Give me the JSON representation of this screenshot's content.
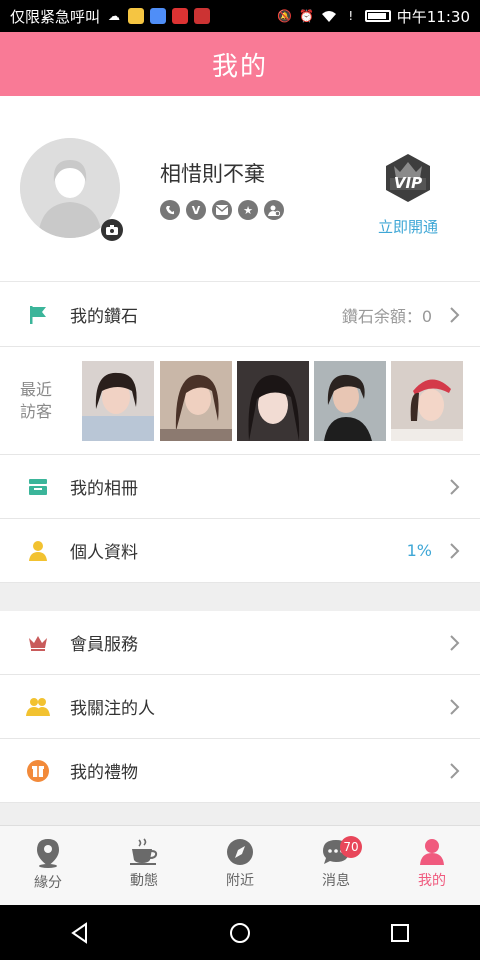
{
  "status_bar": {
    "carrier_text": "仅限紧急呼叫",
    "time": "中午11:30"
  },
  "header": {
    "title": "我的"
  },
  "profile": {
    "nickname": "相惜則不棄",
    "vip_action": "立即開通",
    "vip_badge": "VIP"
  },
  "diamond_row": {
    "label": "我的鑽石",
    "value": "鑽石余額：0"
  },
  "visitors": {
    "title": "最近訪客",
    "count": 5
  },
  "menu": {
    "album": {
      "label": "我的相冊"
    },
    "personal_info": {
      "label": "個人資料",
      "value": "1%"
    },
    "membership": {
      "label": "會員服務"
    },
    "following": {
      "label": "我關注的人"
    },
    "gifts": {
      "label": "我的禮物"
    }
  },
  "tabs": [
    {
      "label": "緣分",
      "icon": "location-pin-icon"
    },
    {
      "label": "動態",
      "icon": "coffee-icon"
    },
    {
      "label": "附近",
      "icon": "compass-icon"
    },
    {
      "label": "消息",
      "icon": "chat-icon",
      "badge": "70"
    },
    {
      "label": "我的",
      "icon": "person-icon",
      "active": true
    }
  ],
  "colors": {
    "brand_pink": "#f97a96",
    "link_blue": "#3fa7d6",
    "active_tab": "#f05a7e",
    "badge_red": "#e8465a"
  }
}
